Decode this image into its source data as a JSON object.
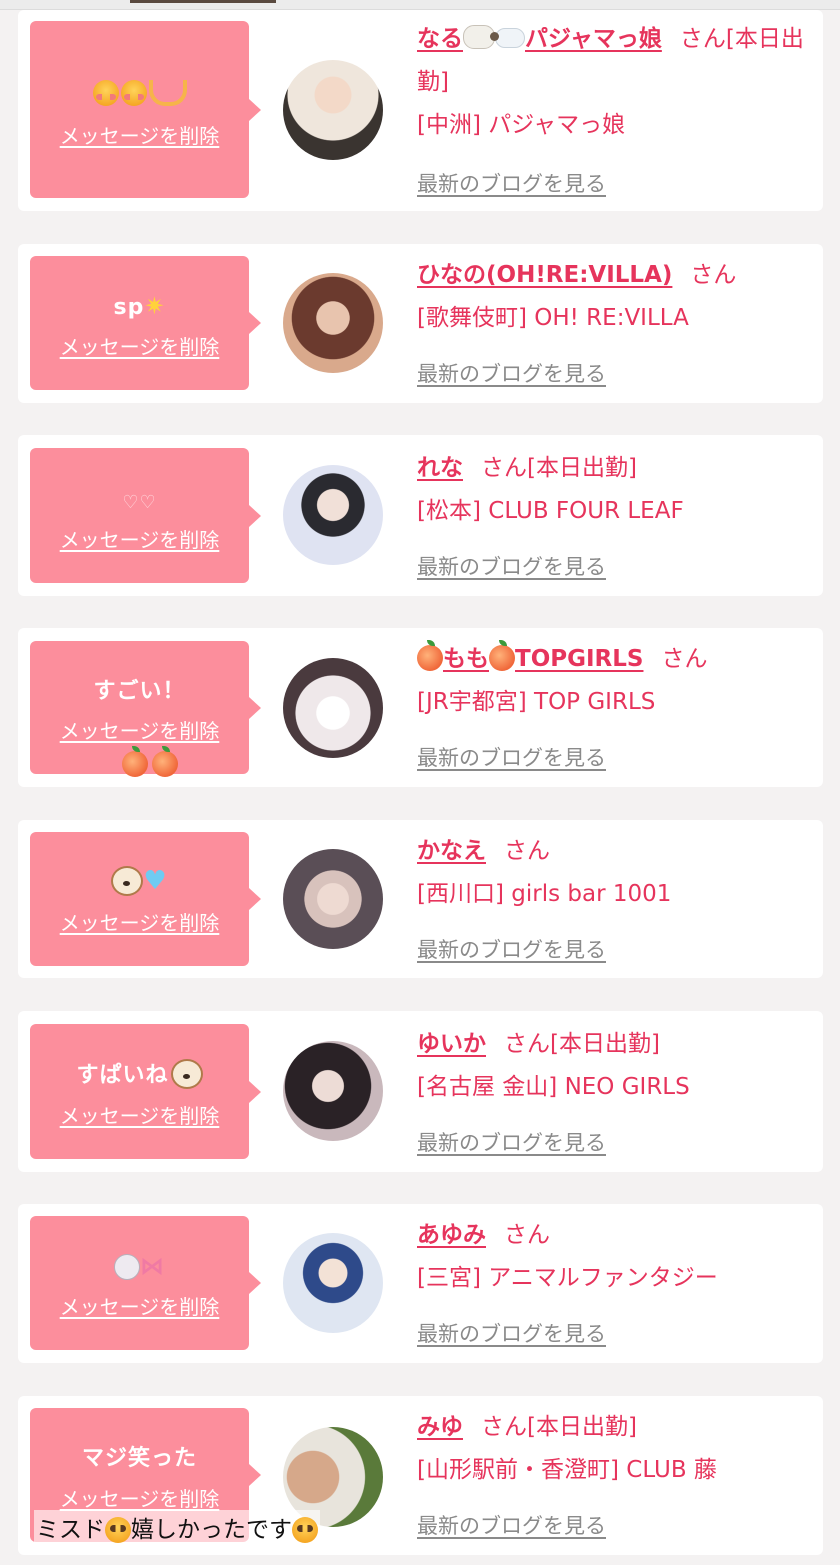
{
  "labels": {
    "delete_message": "メッセージを削除",
    "san": "さん",
    "view_blog": "最新のブログを見る"
  },
  "entries": [
    {
      "message_text": "",
      "message_icons": [
        "smiling-face-with-hearts",
        "smiling-face-with-hearts",
        "heart-hands"
      ],
      "name": "なる🐑💭パジャマっ娘",
      "name_text": "なる",
      "name_suffix_text": "パジャマっ娘",
      "status": "[本日出勤]",
      "store": "[中洲] パジャマっ娘",
      "avatar_colors": [
        "#efe6dc",
        "#3a3430"
      ]
    },
    {
      "message_text": "sp",
      "message_icons": [
        "glowing-star"
      ],
      "name": "ひなの(OH!RE:VILLA)",
      "status": "",
      "store": "[歌舞伎町] OH! RE:VILLA",
      "avatar_colors": [
        "#6b3a2e",
        "#d9a98c"
      ]
    },
    {
      "message_text": "♡♡",
      "message_icons": [],
      "name": "れな",
      "status": "[本日出勤]",
      "store": "[松本] CLUB FOUR LEAF",
      "avatar_colors": [
        "#dfe3f2",
        "#2a2a30"
      ]
    },
    {
      "message_text": "すごい！",
      "message_icons": [],
      "name": "🍑もも🍑TOPGIRLS",
      "name_text": "もも",
      "name_suffix_text": "TOPGIRLS",
      "status": "",
      "store": "[JR宇都宮] TOP GIRLS",
      "avatar_colors": [
        "#efe8ea",
        "#4a3a3e"
      ]
    },
    {
      "message_text": "",
      "message_icons": [
        "dog-face",
        "light-blue-heart"
      ],
      "name": "かなえ",
      "status": "",
      "store": "[西川口] girls bar 1001",
      "avatar_colors": [
        "#5a4e56",
        "#d8c2bc"
      ]
    },
    {
      "message_text": "すぱいね",
      "message_icons": [
        "dog-face"
      ],
      "name": "ゆいか",
      "status": "[本日出勤]",
      "store": "[名古屋 金山] NEO GIRLS",
      "avatar_colors": [
        "#2a2226",
        "#c9b8bc"
      ]
    },
    {
      "message_text": "",
      "message_icons": [
        "rabbit-face",
        "ribbon"
      ],
      "name": "あゆみ",
      "status": "",
      "store": "[三宮] アニマルファンタジー",
      "avatar_colors": [
        "#dfe6f2",
        "#2e4a8a"
      ]
    },
    {
      "message_text": "マジ笑った",
      "message_icons": [],
      "name": "みゆ",
      "status": "[本日出勤]",
      "store": "[山形駅前・香澄町] CLUB 藤",
      "avatar_colors": [
        "#d6a88a",
        "#5a7a3a"
      ]
    }
  ],
  "overlay": {
    "caption_before": "ミスド",
    "caption_middle": "嬉しかったです",
    "caption_icons": [
      "pleading-face",
      "pleading-face"
    ],
    "sticker_icons": [
      "peach",
      "peach"
    ]
  },
  "colors": {
    "bubble": "#fc8e9c",
    "name": "#e6345c",
    "link_gray": "#8a8a8a"
  }
}
